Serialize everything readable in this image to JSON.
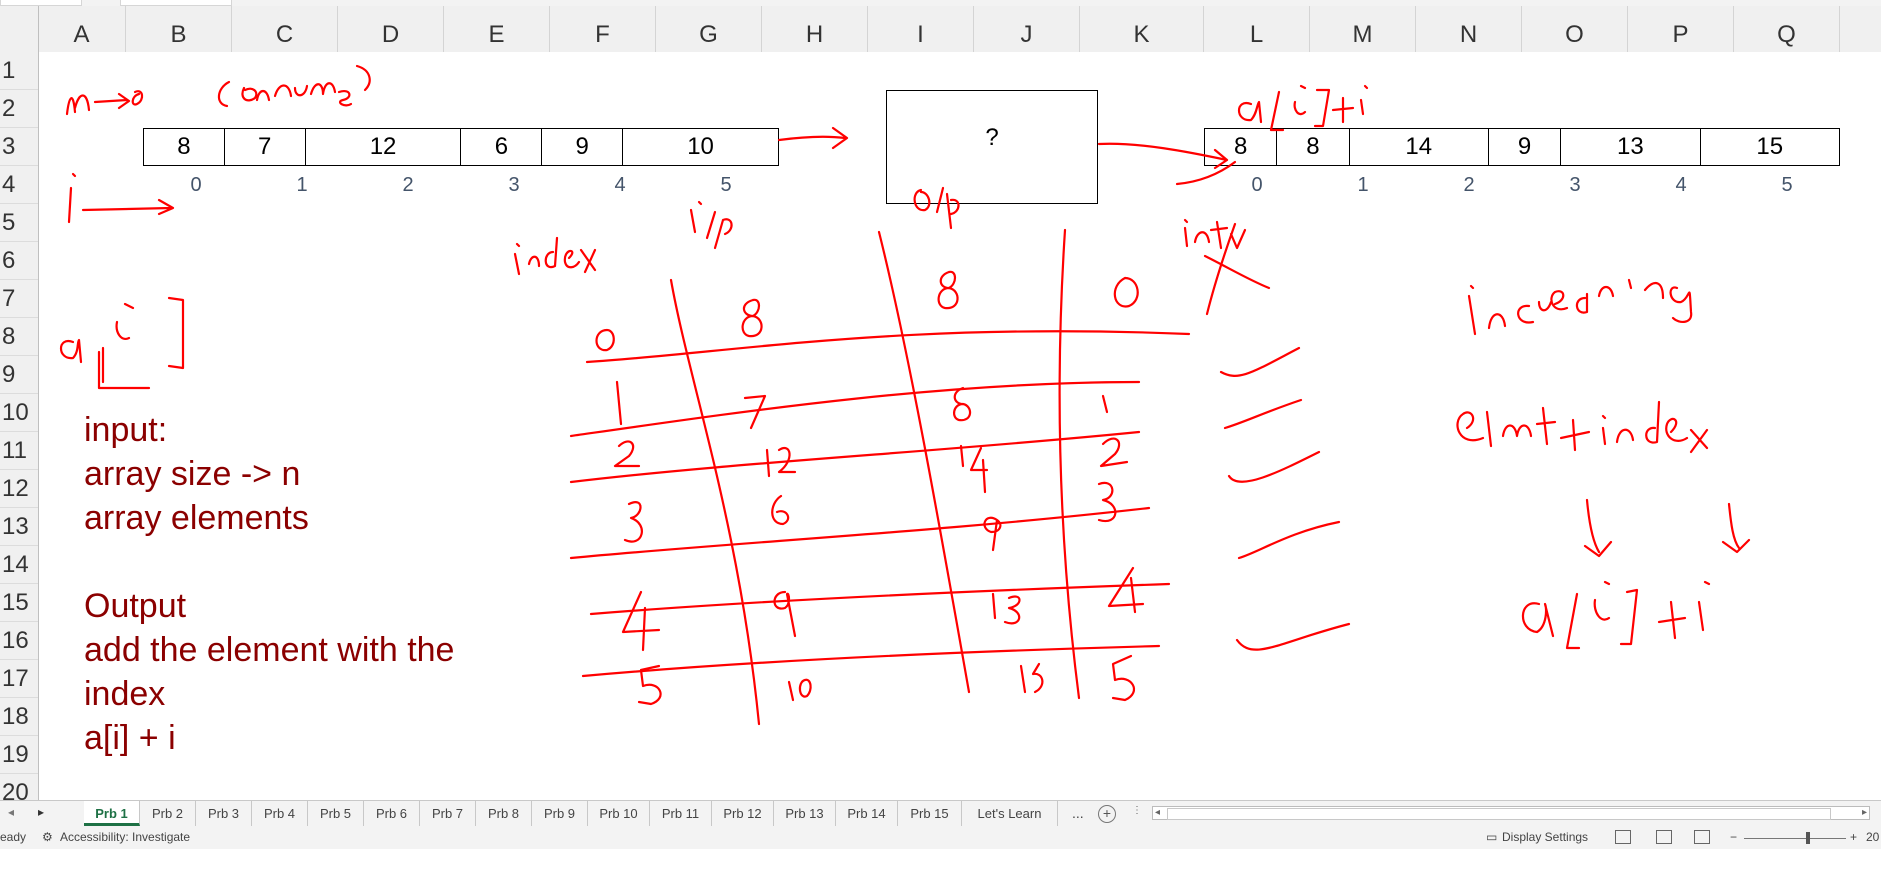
{
  "columns": [
    "A",
    "B",
    "C",
    "D",
    "E",
    "F",
    "G",
    "H",
    "I",
    "J",
    "K",
    "L",
    "M",
    "N",
    "O",
    "P",
    "Q"
  ],
  "rows": [
    "1",
    "2",
    "3",
    "4",
    "5",
    "6",
    "7",
    "8",
    "9",
    "10",
    "11",
    "12",
    "13",
    "14",
    "15",
    "16",
    "17",
    "18",
    "19",
    "20"
  ],
  "input_array": [
    "8",
    "7",
    "12",
    "6",
    "9",
    "10"
  ],
  "input_indices": [
    "0",
    "1",
    "2",
    "3",
    "4",
    "5"
  ],
  "output_array": [
    "8",
    "8",
    "14",
    "9",
    "13",
    "15"
  ],
  "output_indices": [
    "0",
    "1",
    "2",
    "3",
    "4",
    "5"
  ],
  "process_box": "?",
  "notes": {
    "line1": "input:",
    "line2": "array size -> n",
    "line3": "array elements",
    "line4": "Output",
    "line5": "add the element with the",
    "line6": "index",
    "line7": "a[i] + i"
  },
  "sheet_tabs": [
    "Prb 1",
    "Prb 2",
    "Prb 3",
    "Prb 4",
    "Prb 5",
    "Prb 6",
    "Prb 7",
    "Prb 8",
    "Prb 9",
    "Prb 10",
    "Prb 11",
    "Prb 12",
    "Prb 13",
    "Prb 14",
    "Prb 15",
    "Let's Learn"
  ],
  "active_tab": "Prb 1",
  "tabs_more": "...",
  "status": {
    "ready": "eady",
    "accessibility": "Accessibility: Investigate",
    "display_settings": "Display Settings",
    "zoom_minus": "−",
    "zoom_plus": "+",
    "zoom_level": "20"
  },
  "colors": {
    "ink": "#ff0000",
    "note_text": "#8b0000",
    "index_text": "#44546a",
    "active_tab": "#1e7145"
  }
}
